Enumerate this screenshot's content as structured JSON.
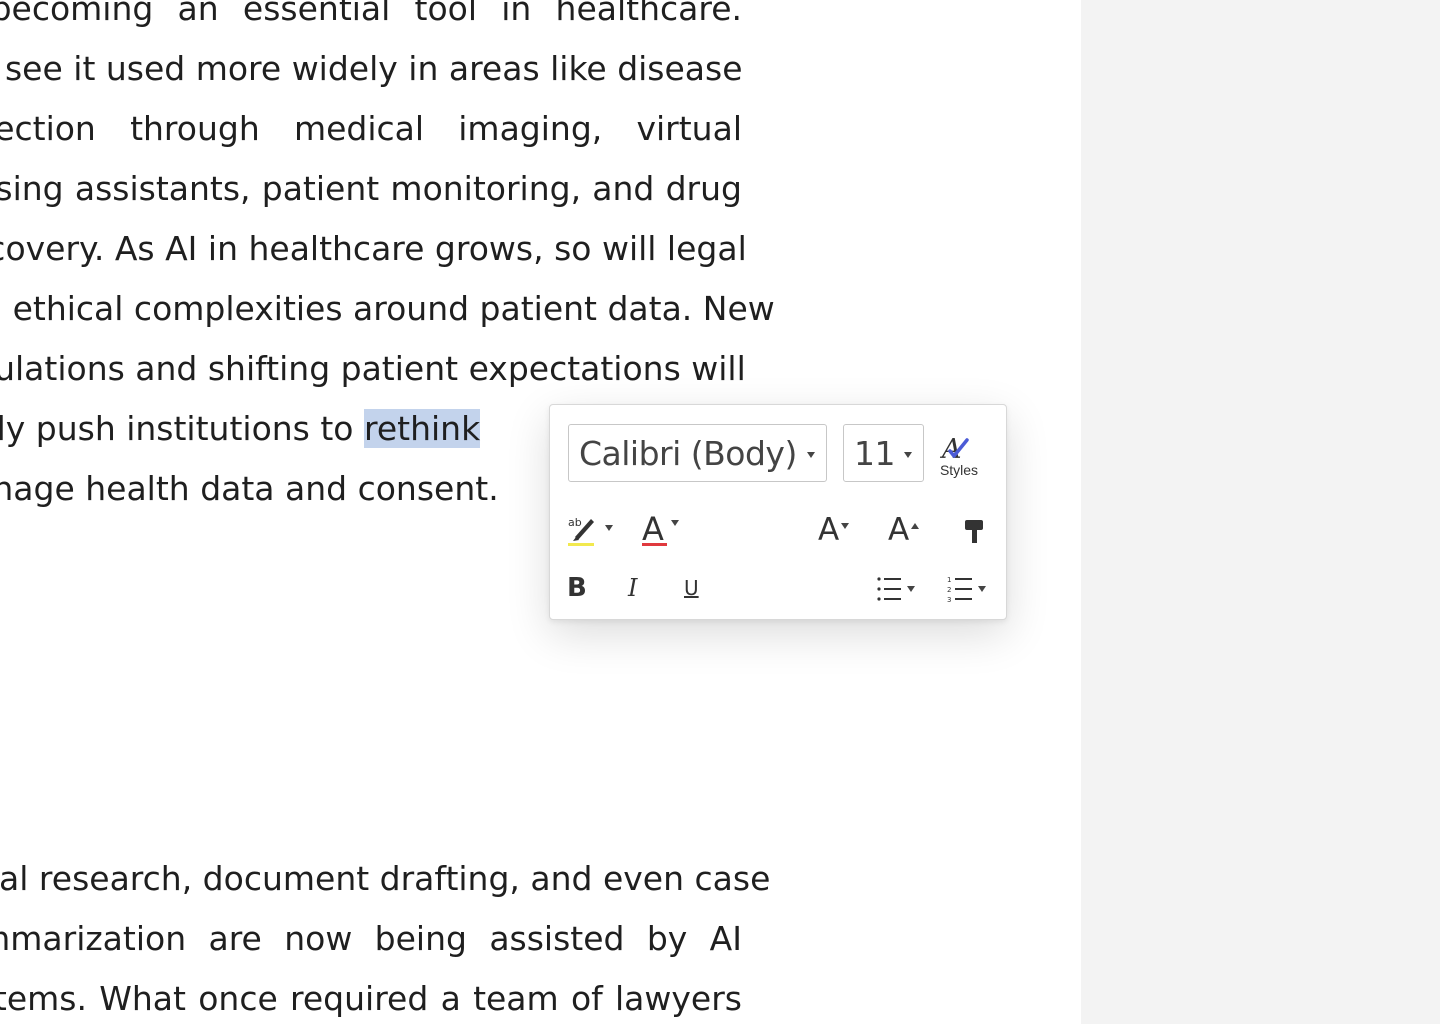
{
  "document": {
    "paragraph1": [
      "is becoming an essential tool in healthcare.",
      "will see it used more widely in areas like disease",
      "detection through medical imaging, virtual",
      "nursing assistants, patient monitoring, and drug",
      "discovery. As AI in healthcare grows, so will legal",
      "and ethical complexities around patient data. New",
      "regulations and shifting patient expectations will",
      "likely push institutions to",
      "manage health data and consent."
    ],
    "selected_word": "rethink",
    "paragraph2": [
      "Legal research, document drafting, and even case",
      "summarization are now being assisted by AI",
      "systems. What once required a team of lawyers"
    ]
  },
  "toolbar": {
    "font_name": "Calibri (Body)",
    "font_size": "11",
    "styles_label": "Styles",
    "highlight_icon": "highlighter-icon",
    "font_color_icon": "font-color-icon",
    "shrink_icon": "decrease-font-size-icon",
    "grow_icon": "increase-font-size-icon",
    "format_painter_icon": "format-painter-icon",
    "bold_icon": "bold-icon",
    "italic_icon": "italic-icon",
    "underline_icon": "underline-icon",
    "bullets_icon": "bulleted-list-icon",
    "numbering_icon": "numbered-list-icon"
  },
  "colors": {
    "selection": "#c3d3ec",
    "highlight": "#f2e94e",
    "font_color": "#e0393e",
    "styles_accent": "#4b5bd6"
  }
}
